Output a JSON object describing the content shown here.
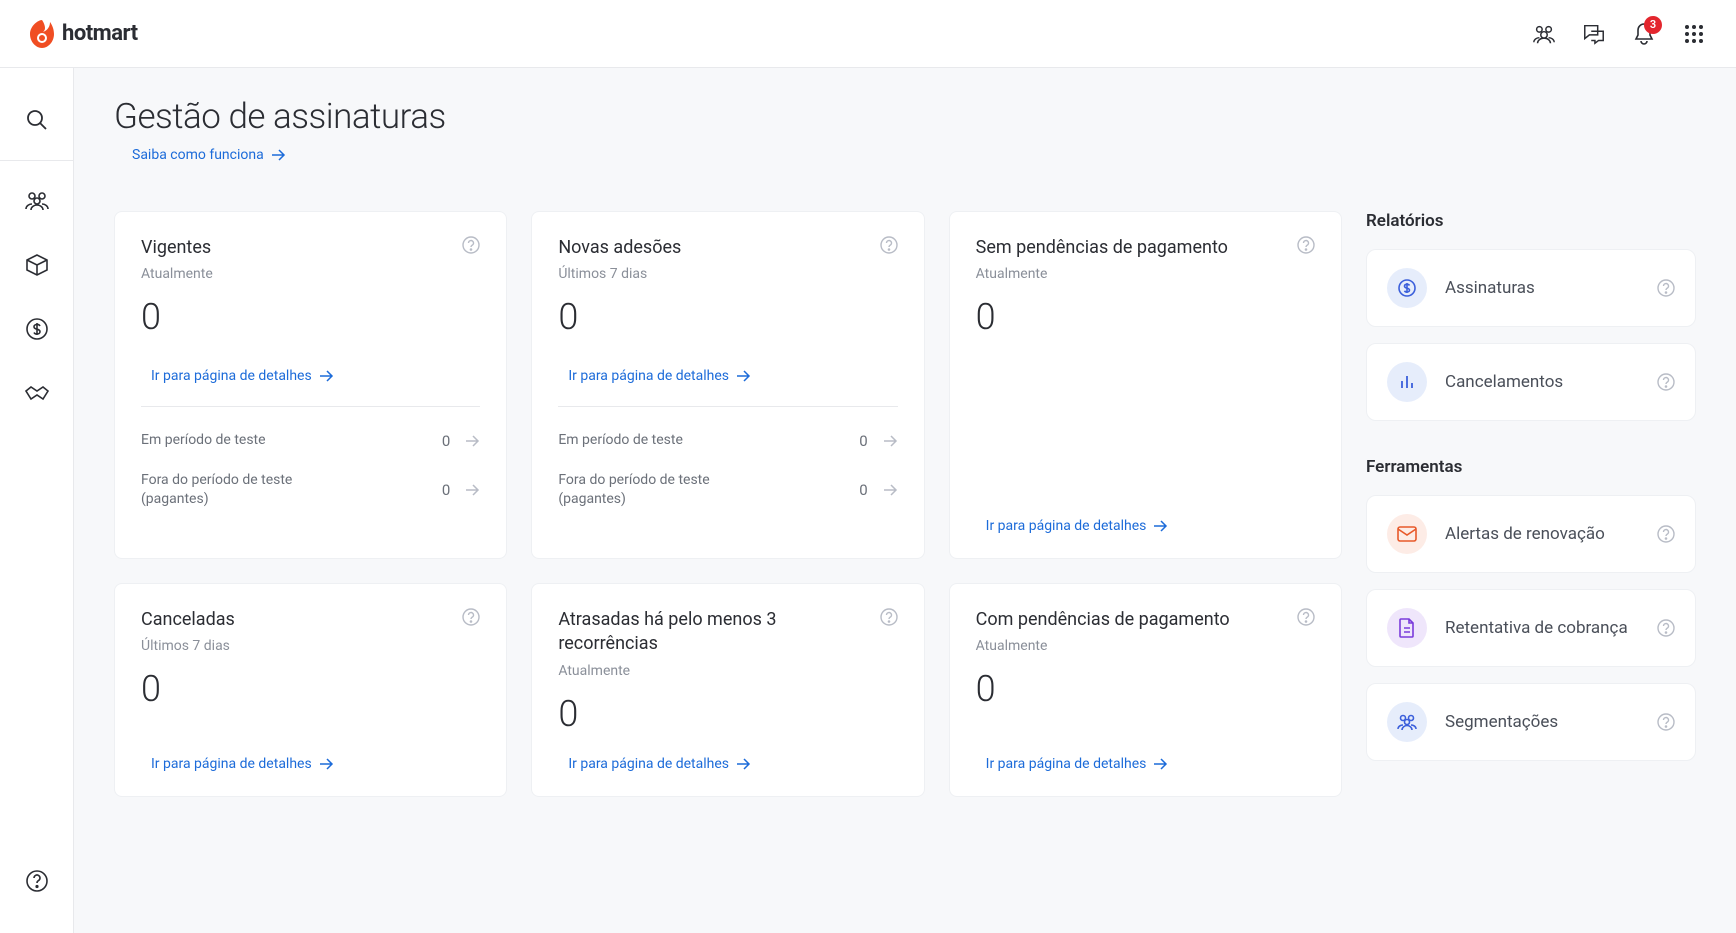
{
  "brand": {
    "name": "hotmart"
  },
  "header": {
    "notification_count": "3"
  },
  "page": {
    "title": "Gestão de assinaturas",
    "learn_link": "Saiba como funciona"
  },
  "labels": {
    "currently": "Atualmente",
    "last7": "Últimos 7 dias",
    "details_link": "Ir para página de detalhes",
    "in_trial": "Em período de teste",
    "out_trial": "Fora do período de teste (pagantes)"
  },
  "cards": {
    "active": {
      "title": "Vigentes",
      "sub": "Atualmente",
      "value": "0",
      "breakdown": [
        {
          "label": "Em período de teste",
          "val": "0"
        },
        {
          "label": "Fora do período de teste (pagantes)",
          "val": "0"
        }
      ]
    },
    "new": {
      "title": "Novas adesões",
      "sub": "Últimos 7 dias",
      "value": "0",
      "breakdown": [
        {
          "label": "Em período de teste",
          "val": "0"
        },
        {
          "label": "Fora do período de teste (pagantes)",
          "val": "0"
        }
      ]
    },
    "no_pending": {
      "title": "Sem pendências de pagamento",
      "sub": "Atualmente",
      "value": "0"
    },
    "cancelled": {
      "title": "Canceladas",
      "sub": "Últimos 7 dias",
      "value": "0"
    },
    "late": {
      "title": "Atrasadas há pelo menos 3 recorrências",
      "sub": "Atualmente",
      "value": "0"
    },
    "with_pending": {
      "title": "Com pendências de pagamento",
      "sub": "Atualmente",
      "value": "0"
    }
  },
  "side": {
    "reports_title": "Relatórios",
    "tools_title": "Ferramentas",
    "reports": [
      {
        "label": "Assinaturas",
        "icon": "dollar",
        "color": "blue"
      },
      {
        "label": "Cancelamentos",
        "icon": "bars",
        "color": "blue"
      }
    ],
    "tools": [
      {
        "label": "Alertas de renovação",
        "icon": "mail",
        "color": "orange"
      },
      {
        "label": "Retentativa de cobrança",
        "icon": "doc",
        "color": "purple"
      },
      {
        "label": "Segmentações",
        "icon": "people",
        "color": "blue"
      }
    ]
  }
}
